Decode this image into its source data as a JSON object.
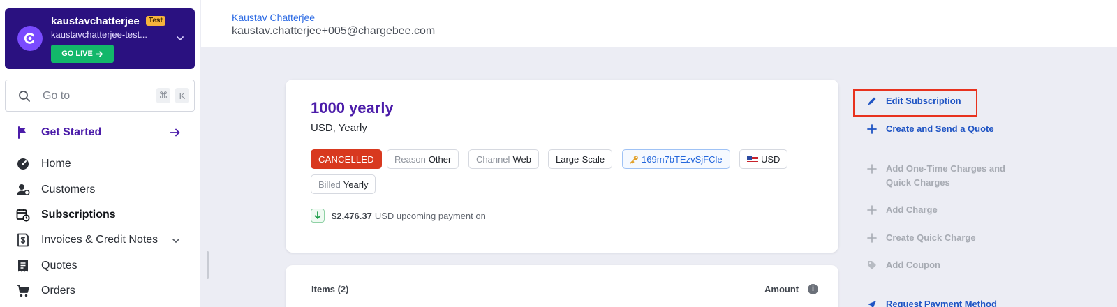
{
  "sidebar": {
    "account": {
      "name": "kaustavchatterjee",
      "badge": "Test",
      "site": "kaustavchatterjee-test...",
      "go_live_label": "GO LIVE",
      "logo_icon": "chargebee-logo-icon"
    },
    "search": {
      "placeholder": "Go to",
      "shortcut_modifier": "⌘",
      "shortcut_key": "K"
    },
    "get_started": {
      "label": "Get Started",
      "icon": "flag-icon"
    },
    "nav_items": [
      {
        "label": "Home",
        "icon": "speedometer-icon",
        "active": false
      },
      {
        "label": "Customers",
        "icon": "users-icon",
        "active": false
      },
      {
        "label": "Subscriptions",
        "icon": "calendar-clock-icon",
        "active": true
      },
      {
        "label": "Invoices & Credit Notes",
        "icon": "invoice-icon",
        "active": false,
        "expandable": true
      },
      {
        "label": "Quotes",
        "icon": "quote-icon",
        "active": false
      },
      {
        "label": "Orders",
        "icon": "cart-icon",
        "active": false
      }
    ]
  },
  "header": {
    "customer_name": "Kaustav Chatterjee",
    "customer_email": "kaustav.chatterjee+005@chargebee.com"
  },
  "subscription": {
    "plan_title": "1000 yearly",
    "plan_subtitle": "USD, Yearly",
    "status": "CANCELLED",
    "tags": {
      "reason_key": "Reason",
      "reason_value": "Other",
      "channel_key": "Channel",
      "channel_value": "Web",
      "segment": "Large-Scale",
      "subscription_id": "169m7bTEzvSjFCle",
      "currency": "USD",
      "billed_key": "Billed",
      "billed_value": "Yearly"
    },
    "upcoming_amount": "$2,476.37",
    "upcoming_text": "USD upcoming payment on"
  },
  "items_section": {
    "items_label": "Items (2)",
    "amount_label": "Amount"
  },
  "actions": {
    "edit_subscription": "Edit Subscription",
    "create_send_quote": "Create and Send a Quote",
    "add_one_time_charges": "Add One-Time Charges and Quick Charges",
    "add_charge": "Add Charge",
    "create_quick_charge": "Create Quick Charge",
    "add_coupon": "Add Coupon",
    "request_payment_method": "Request Payment Method"
  },
  "colors": {
    "brand_purple": "#4b1ca9",
    "account_card_bg": "#2a1180",
    "go_live_green": "#12b76a",
    "status_cancelled": "#d8391f",
    "link_blue": "#1f54c4",
    "highlight_red": "#e8321e"
  }
}
